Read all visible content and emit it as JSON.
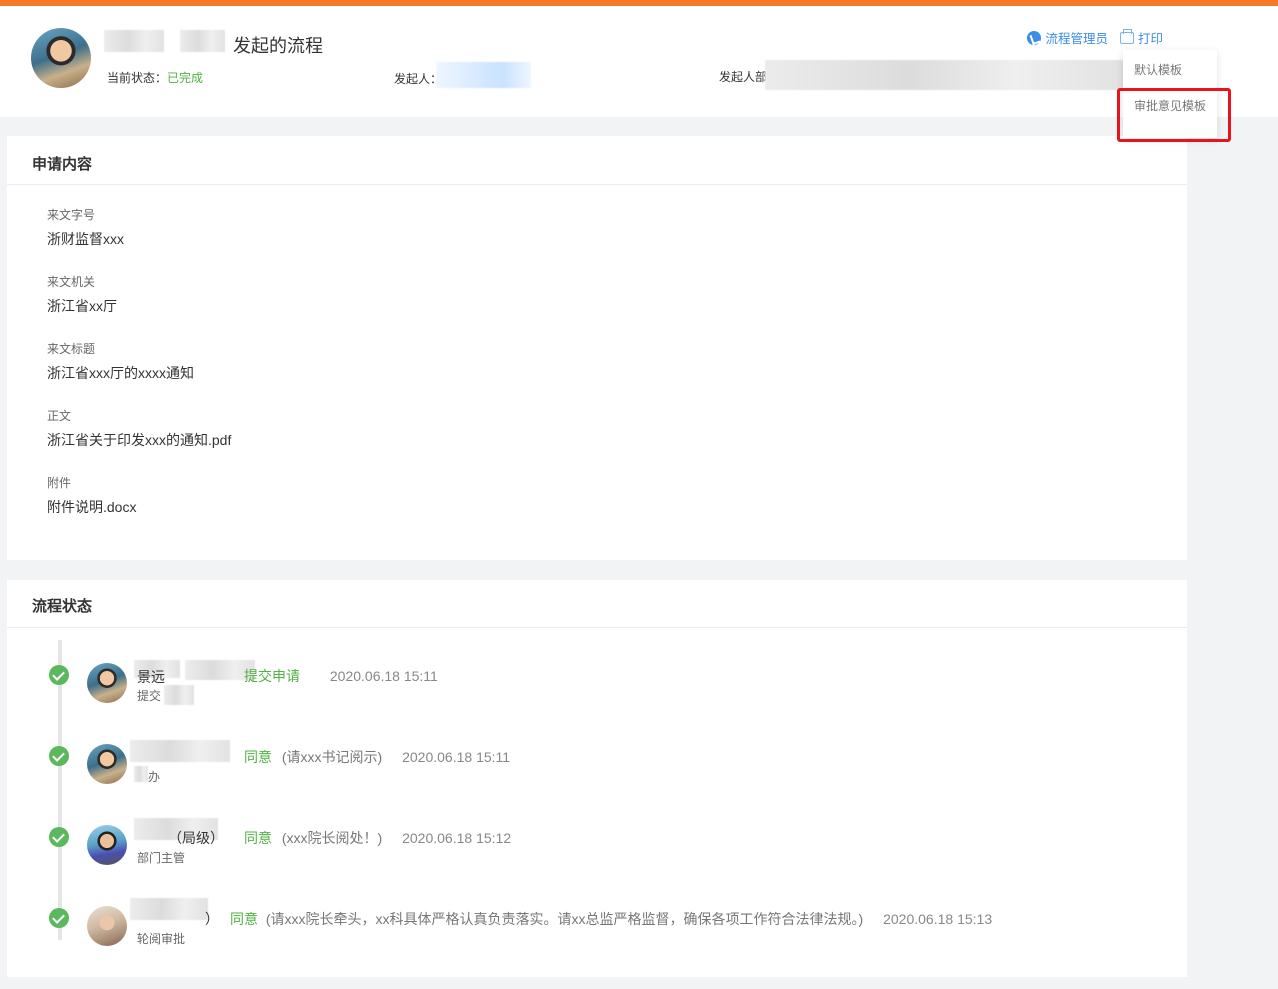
{
  "header": {
    "title_suffix": "发起的流程",
    "status_label": "当前状态：",
    "status_value": "已完成",
    "initiator_label": "发起人：",
    "dept_label": "发起人部",
    "admin_link": "流程管理员",
    "print_link": "打印"
  },
  "dropdown": {
    "items": [
      "默认模板",
      "审批意见模板"
    ]
  },
  "colors": {
    "accent_orange": "#f77a2b",
    "link_blue": "#3c8de6",
    "success_green": "#52b043",
    "highlight_red": "#e8131c"
  },
  "application": {
    "section_title": "申请内容",
    "fields": [
      {
        "label": "来文字号",
        "value": "浙财监督xxx"
      },
      {
        "label": "来文机关",
        "value": "浙江省xx厅"
      },
      {
        "label": "来文标题",
        "value": "浙江省xxx厅的xxxx通知"
      },
      {
        "label": "正文",
        "value": "浙江省关于印发xxx的通知.pdf"
      },
      {
        "label": "附件",
        "value": "附件说明.docx"
      }
    ]
  },
  "process": {
    "section_title": "流程状态",
    "steps": [
      {
        "name_fragment": "景远",
        "role": "提交",
        "action": "提交申请",
        "note": "",
        "time": "2020.06.18 15:11"
      },
      {
        "name_fragment": "",
        "role": "办",
        "action": "同意",
        "note": "(请xxx书记阅示)",
        "time": "2020.06.18 15:11"
      },
      {
        "name_fragment": "（局级）",
        "role": "部门主管",
        "action": "同意",
        "note": "(xxx院长阅处！)",
        "time": "2020.06.18 15:12"
      },
      {
        "name_fragment": "）",
        "role": "轮阅审批",
        "action": "同意",
        "note": "(请xxx院长牵头，xx科具体严格认真负责落实。请xx总监严格监督，确保各项工作符合法律法规。)",
        "time": "2020.06.18 15:13"
      }
    ]
  }
}
